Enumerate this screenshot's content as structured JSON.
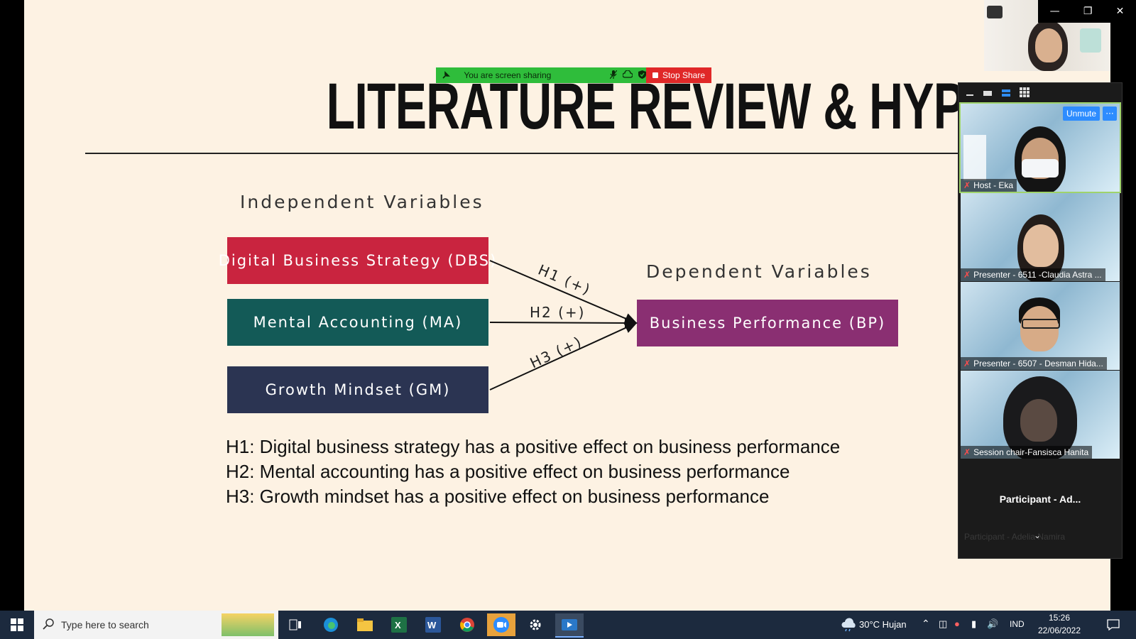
{
  "slide": {
    "title": "LITERATURE REVIEW & HYPOTHESIS",
    "independent_heading": "Independent Variables",
    "dependent_heading": "Dependent Variables",
    "boxes": [
      {
        "label": "Digital Business Strategy (DBS)",
        "color": "#c9243f"
      },
      {
        "label": "Mental Accounting (MA)",
        "color": "#135a57"
      },
      {
        "label": "Growth Mindset (GM)",
        "color": "#2b3452"
      },
      {
        "label": "Business Performance (BP)",
        "color": "#8a2f72"
      }
    ],
    "arrow_labels": [
      "H1 (+)",
      "H2 (+)",
      "H3 (+)"
    ],
    "hypotheses": [
      "H1: Digital business strategy has a positive effect on business performance",
      "H2: Mental accounting has a positive effect on business performance",
      "H3: Growth mindset has a positive effect on business performance"
    ]
  },
  "share_bar": {
    "status": "You are screen sharing",
    "stop_label": "Stop Share",
    "bar_color": "#2fbd3b",
    "stop_color": "#e02828"
  },
  "gallery": {
    "unmute_label": "Unmute",
    "more_label": "···",
    "participants": [
      {
        "name": "Host - Eka"
      },
      {
        "name": "Presenter - 6511 -Claudia Astra ..."
      },
      {
        "name": "Presenter - 6507 - Desman Hida..."
      },
      {
        "name": "Session chair-Fansisca Hanita"
      }
    ],
    "next_participant": "Participant - Ad...",
    "next_participant_faded": "Participant - Adelia Namira"
  },
  "taskbar": {
    "search_placeholder": "Type here to search",
    "weather": "30°C  Hujan",
    "language": "IND",
    "time": "15:26",
    "date": "22/06/2022"
  }
}
